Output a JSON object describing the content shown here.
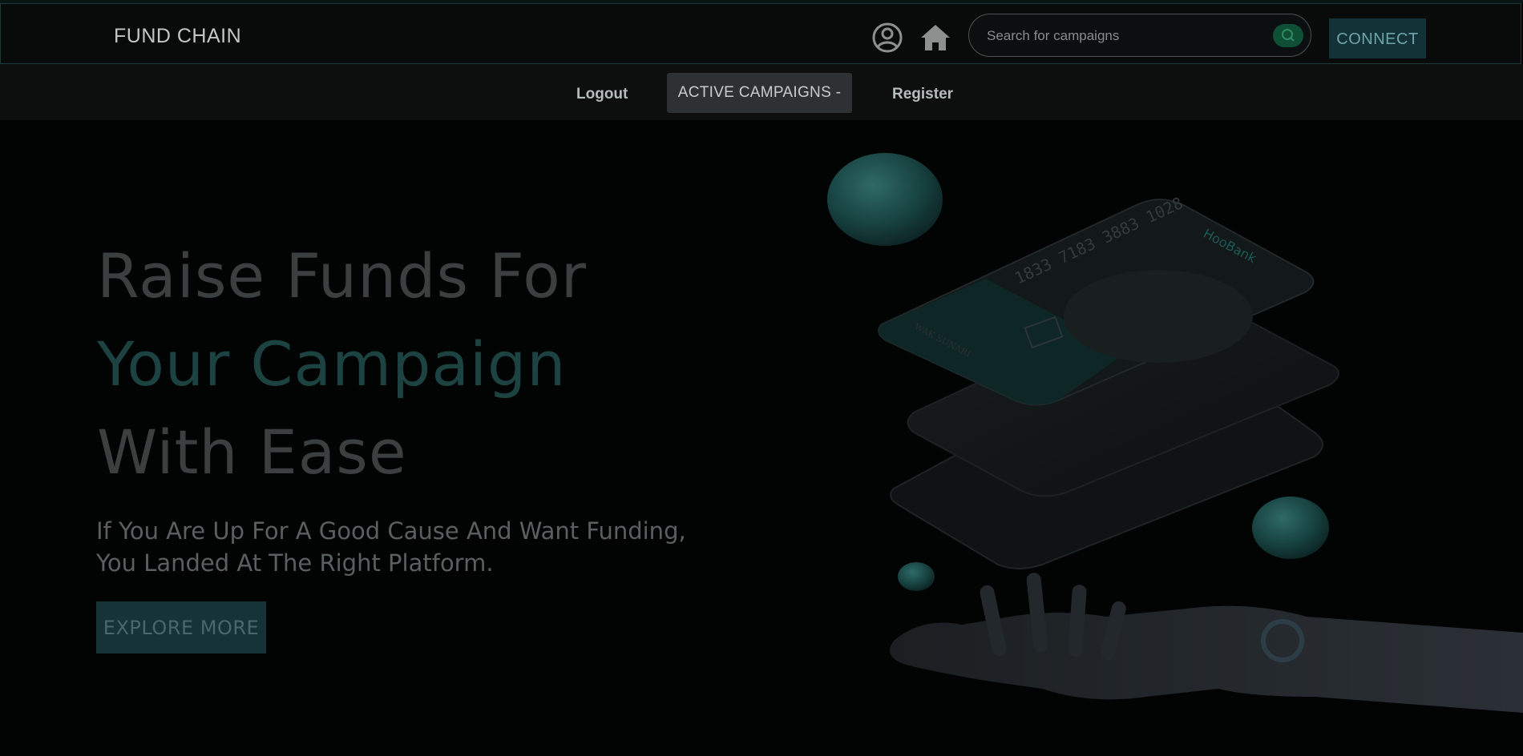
{
  "header": {
    "brand": "FUND CHAIN",
    "profile_icon": "user-circle-icon",
    "home_icon": "home-icon",
    "search": {
      "placeholder": "Search for campaigns",
      "value": "",
      "icon": "search-icon"
    },
    "connect_label": "CONNECT"
  },
  "subnav": {
    "logout": "Logout",
    "campaigns_dropdown": "ACTIVE CAMPAIGNS -",
    "register": "Register"
  },
  "hero": {
    "line1": "Raise Funds For",
    "line2": "Your Campaign",
    "line3": "With Ease",
    "subtitle": "If You Are Up For A Good Cause And Want Funding, You Landed At The Right Platform.",
    "cta": "EXPLORE MORE"
  },
  "illustration": {
    "card_number": "1833 7183 3883 1028",
    "card_brand": "HooBank",
    "card_holder": "WAK SUNARI"
  },
  "colors": {
    "accent": "#163438",
    "teal_text": "#1c4341",
    "background": "#020303"
  }
}
